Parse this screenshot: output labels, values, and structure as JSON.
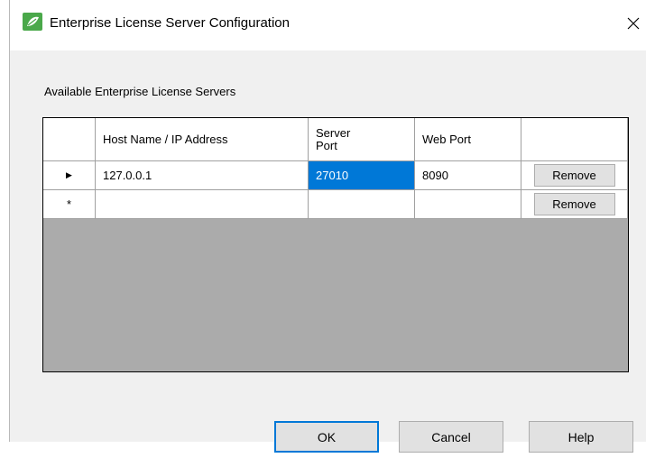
{
  "window": {
    "title": "Enterprise License Server Configuration",
    "close_glyph": "✕",
    "icon": "app-leaf-icon"
  },
  "section": {
    "label": "Available Enterprise License Servers"
  },
  "grid": {
    "columns": {
      "host": "Host Name / IP Address",
      "server_port_line1": "Server",
      "server_port_line2": "Port",
      "web_port": "Web Port"
    },
    "rows": [
      {
        "indicator": "▶",
        "host": "127.0.0.1",
        "server_port": "27010",
        "web_port": "8090",
        "action": "Remove"
      },
      {
        "indicator": "*",
        "host": "",
        "server_port": "",
        "web_port": "",
        "action": "Remove"
      }
    ],
    "selected_color": "#0078d7"
  },
  "buttons": {
    "ok": "OK",
    "cancel": "Cancel",
    "help": "Help"
  }
}
